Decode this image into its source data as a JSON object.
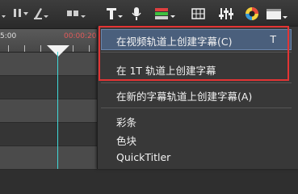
{
  "toolbar": {
    "icons": [
      "split-icon",
      "trim-icon",
      "slide-icon",
      "title-icon",
      "microphone-icon",
      "audio-mixer-icon",
      "grid-icon",
      "eq-icon",
      "color-icon",
      "panel-icon"
    ]
  },
  "ruler": {
    "time_left": "5:00",
    "time_right": "00:00:20"
  },
  "menu": {
    "items": [
      {
        "label": "在视频轨道上创建字幕(C)",
        "shortcut": "T"
      },
      {
        "label": "在 1T 轨道上创建字幕",
        "shortcut": ""
      },
      {
        "label": "在新的字幕轨道上创建字幕(A)",
        "shortcut": ""
      },
      {
        "label": "彩条",
        "shortcut": ""
      },
      {
        "label": "色块",
        "shortcut": ""
      },
      {
        "label": "QuickTitler",
        "shortcut": ""
      }
    ]
  },
  "colors": {
    "highlight": "#4a5f7c",
    "annotation": "#e23434",
    "playhead": "#3fd9d9"
  }
}
